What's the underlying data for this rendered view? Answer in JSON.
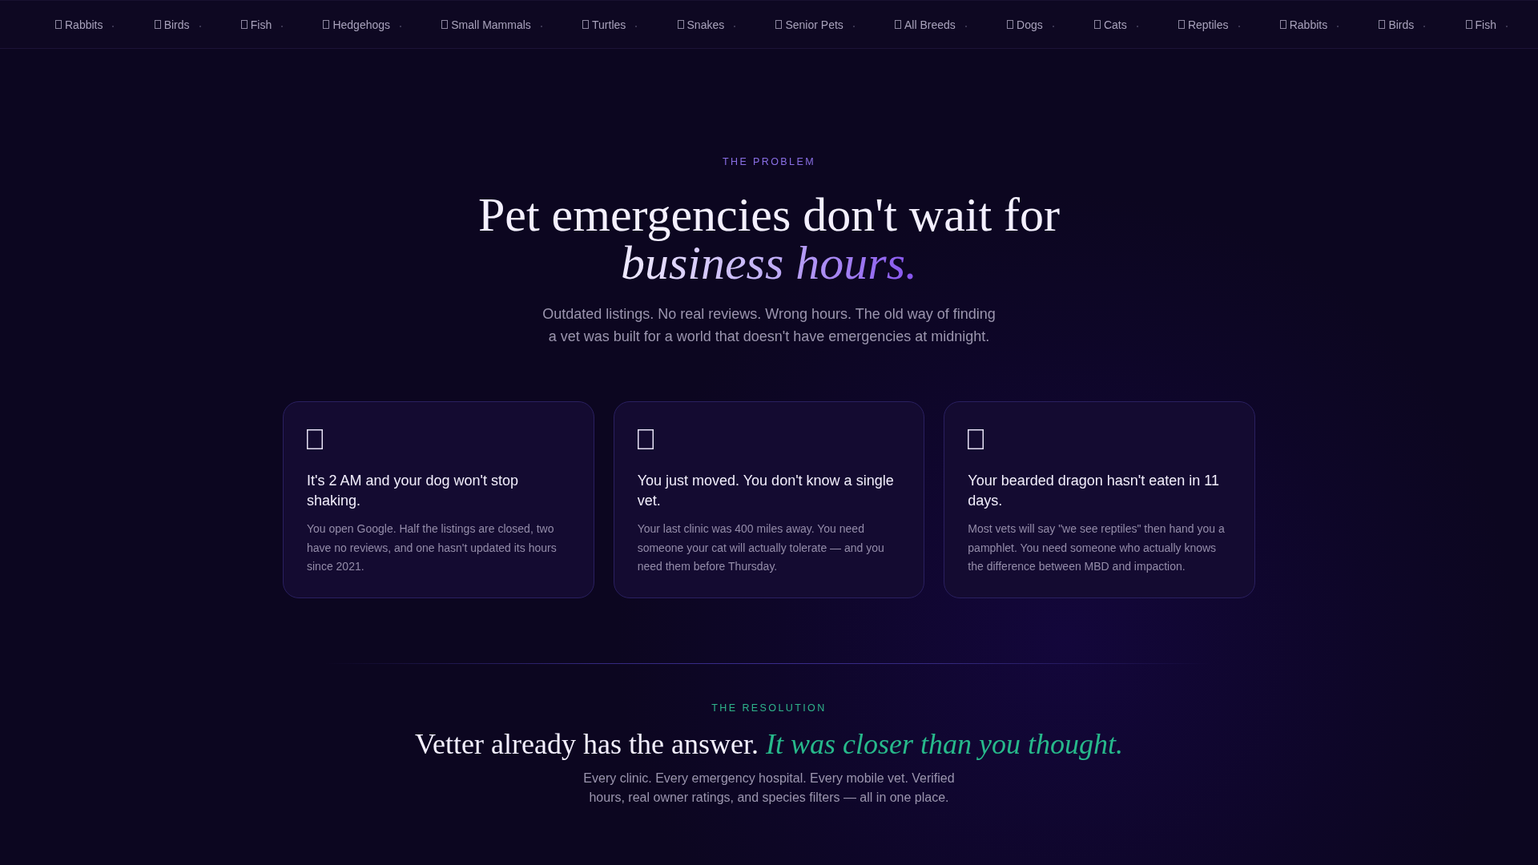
{
  "ticker": {
    "items": [
      "Rabbits",
      "Birds",
      "Fish",
      "Hedgehogs",
      "Small Mammals",
      "Turtles",
      "Snakes",
      "Senior Pets",
      "All Breeds",
      "Dogs",
      "Cats",
      "Reptiles",
      "Rabbits",
      "Birds",
      "Fish"
    ]
  },
  "problem": {
    "eyebrow": "THE PROBLEM",
    "title": "Pet emergencies don't wait for *business hours.*",
    "lead": "Outdated listings. No real reviews. Wrong hours. The old way of finding a vet was built for a world that doesn't have emergencies at midnight."
  },
  "cards": [
    {
      "title": "It's 2 AM and your dog won't stop shaking.",
      "body": "You open Google. Half the listings are closed, two have no reviews, and one hasn't updated its hours since 2021."
    },
    {
      "title": "You just moved. You don't know a single vet.",
      "body": "Your last clinic was 400 miles away. You need someone your cat will actually tolerate — and you need them before Thursday."
    },
    {
      "title": "Your bearded dragon hasn't eaten in 11 days.",
      "body": "Most vets will say \"we see reptiles\" then hand you a pamphlet. You need someone who actually knows the difference between MBD and impaction."
    }
  ],
  "resolution": {
    "eyebrow": "THE RESOLUTION",
    "title": "Vetter already has the answer. *It was closer than you thought.*",
    "lead": "Every clinic. Every emergency hospital. Every mobile vet. Verified hours, real owner ratings, and species filters — all in one place."
  }
}
